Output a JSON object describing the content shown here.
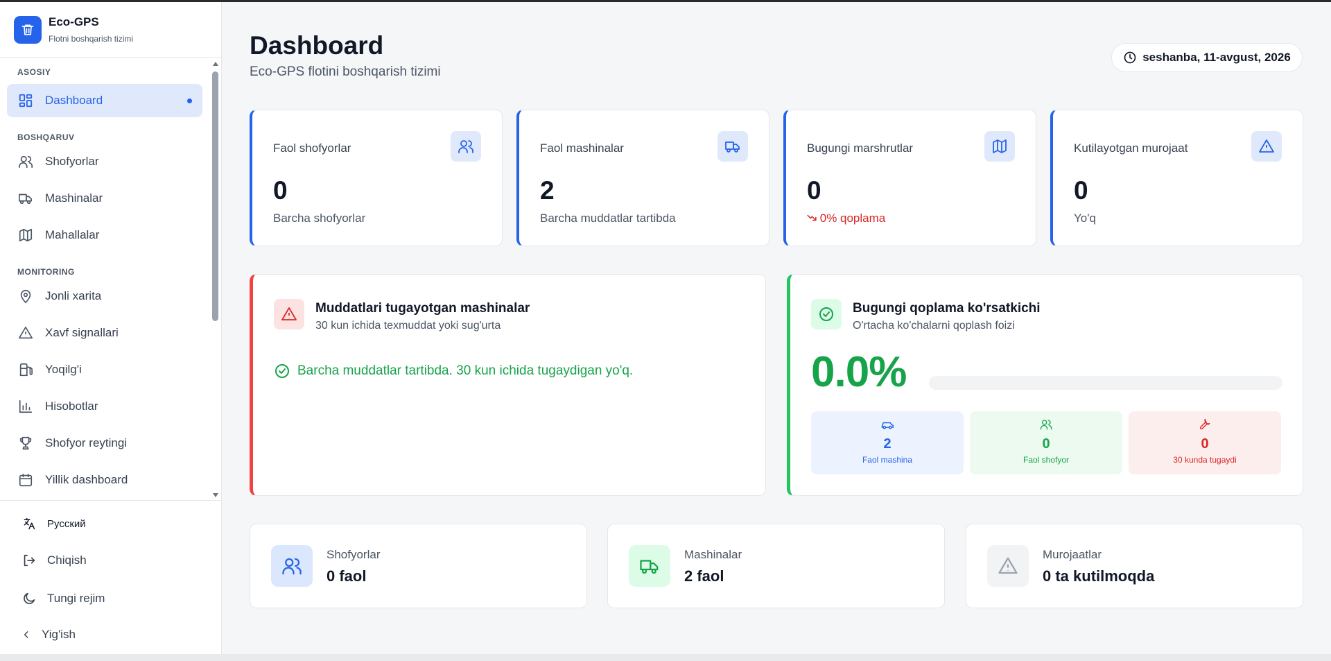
{
  "app": {
    "name": "Eco-GPS",
    "subtitle": "Flotni boshqarish tizimi"
  },
  "sidebar": {
    "sections": [
      "ASOSIY",
      "BOSHQARUV",
      "MONITORING"
    ],
    "items": [
      {
        "label": "Dashboard",
        "icon": "dashboard-icon"
      },
      {
        "label": "Shofyorlar",
        "icon": "users-icon"
      },
      {
        "label": "Mashinalar",
        "icon": "truck-icon"
      },
      {
        "label": "Mahallalar",
        "icon": "map-icon"
      },
      {
        "label": "Jonli xarita",
        "icon": "map-pin-icon"
      },
      {
        "label": "Xavf signallari",
        "icon": "warning-icon"
      },
      {
        "label": "Yoqilg'i",
        "icon": "fuel-icon"
      },
      {
        "label": "Hisobotlar",
        "icon": "bar-chart-icon"
      },
      {
        "label": "Shofyor reytingi",
        "icon": "trophy-icon"
      },
      {
        "label": "Yillik dashboard",
        "icon": "calendar-icon"
      }
    ],
    "bottom": {
      "language": "Русский",
      "logout": "Chiqish",
      "night_mode": "Tungi rejim",
      "collapse": "Yig'ish"
    }
  },
  "header": {
    "title": "Dashboard",
    "subtitle": "Eco-GPS flotini boshqarish tizimi",
    "date": "seshanba, 11-avgust, 2026"
  },
  "stats": [
    {
      "label": "Faol shofyorlar",
      "value": "0",
      "sub": "Barcha shofyorlar",
      "icon": "users-icon"
    },
    {
      "label": "Faol mashinalar",
      "value": "2",
      "sub": "Barcha muddatlar tartibda",
      "icon": "truck-icon"
    },
    {
      "label": "Bugungi marshrutlar",
      "value": "0",
      "sub": "0% qoplama",
      "icon": "map-icon"
    },
    {
      "label": "Kutilayotgan murojaat",
      "value": "0",
      "sub": "Yo'q",
      "icon": "warning-icon"
    }
  ],
  "expiring": {
    "title": "Muddatlari tugayotgan mashinalar",
    "subtitle": "30 kun ichida texmuddat yoki sug'urta",
    "message": "Barcha muddatlar tartibda. 30 kun ichida tugaydigan yo'q."
  },
  "coverage": {
    "title": "Bugungi qoplama ko'rsatkichi",
    "subtitle": "O'rtacha ko'chalarni qoplash foizi",
    "percent_text": "0.0%",
    "progress": 0.0,
    "tiles": [
      {
        "value": "2",
        "label": "Faol mashina",
        "icon": "car-icon"
      },
      {
        "value": "0",
        "label": "Faol shofyor",
        "icon": "users-icon"
      },
      {
        "value": "0",
        "label": "30 kunda tugaydi",
        "icon": "wrench-icon"
      }
    ]
  },
  "summary": [
    {
      "label": "Shofyorlar",
      "value": "0 faol",
      "icon": "users-icon"
    },
    {
      "label": "Mashinalar",
      "value": "2 faol",
      "icon": "truck-icon"
    },
    {
      "label": "Murojaatlar",
      "value": "0 ta kutilmoqda",
      "icon": "warning-icon"
    }
  ],
  "colors": {
    "accent": "#2563eb",
    "success": "#16a34a",
    "danger": "#dc2626"
  }
}
